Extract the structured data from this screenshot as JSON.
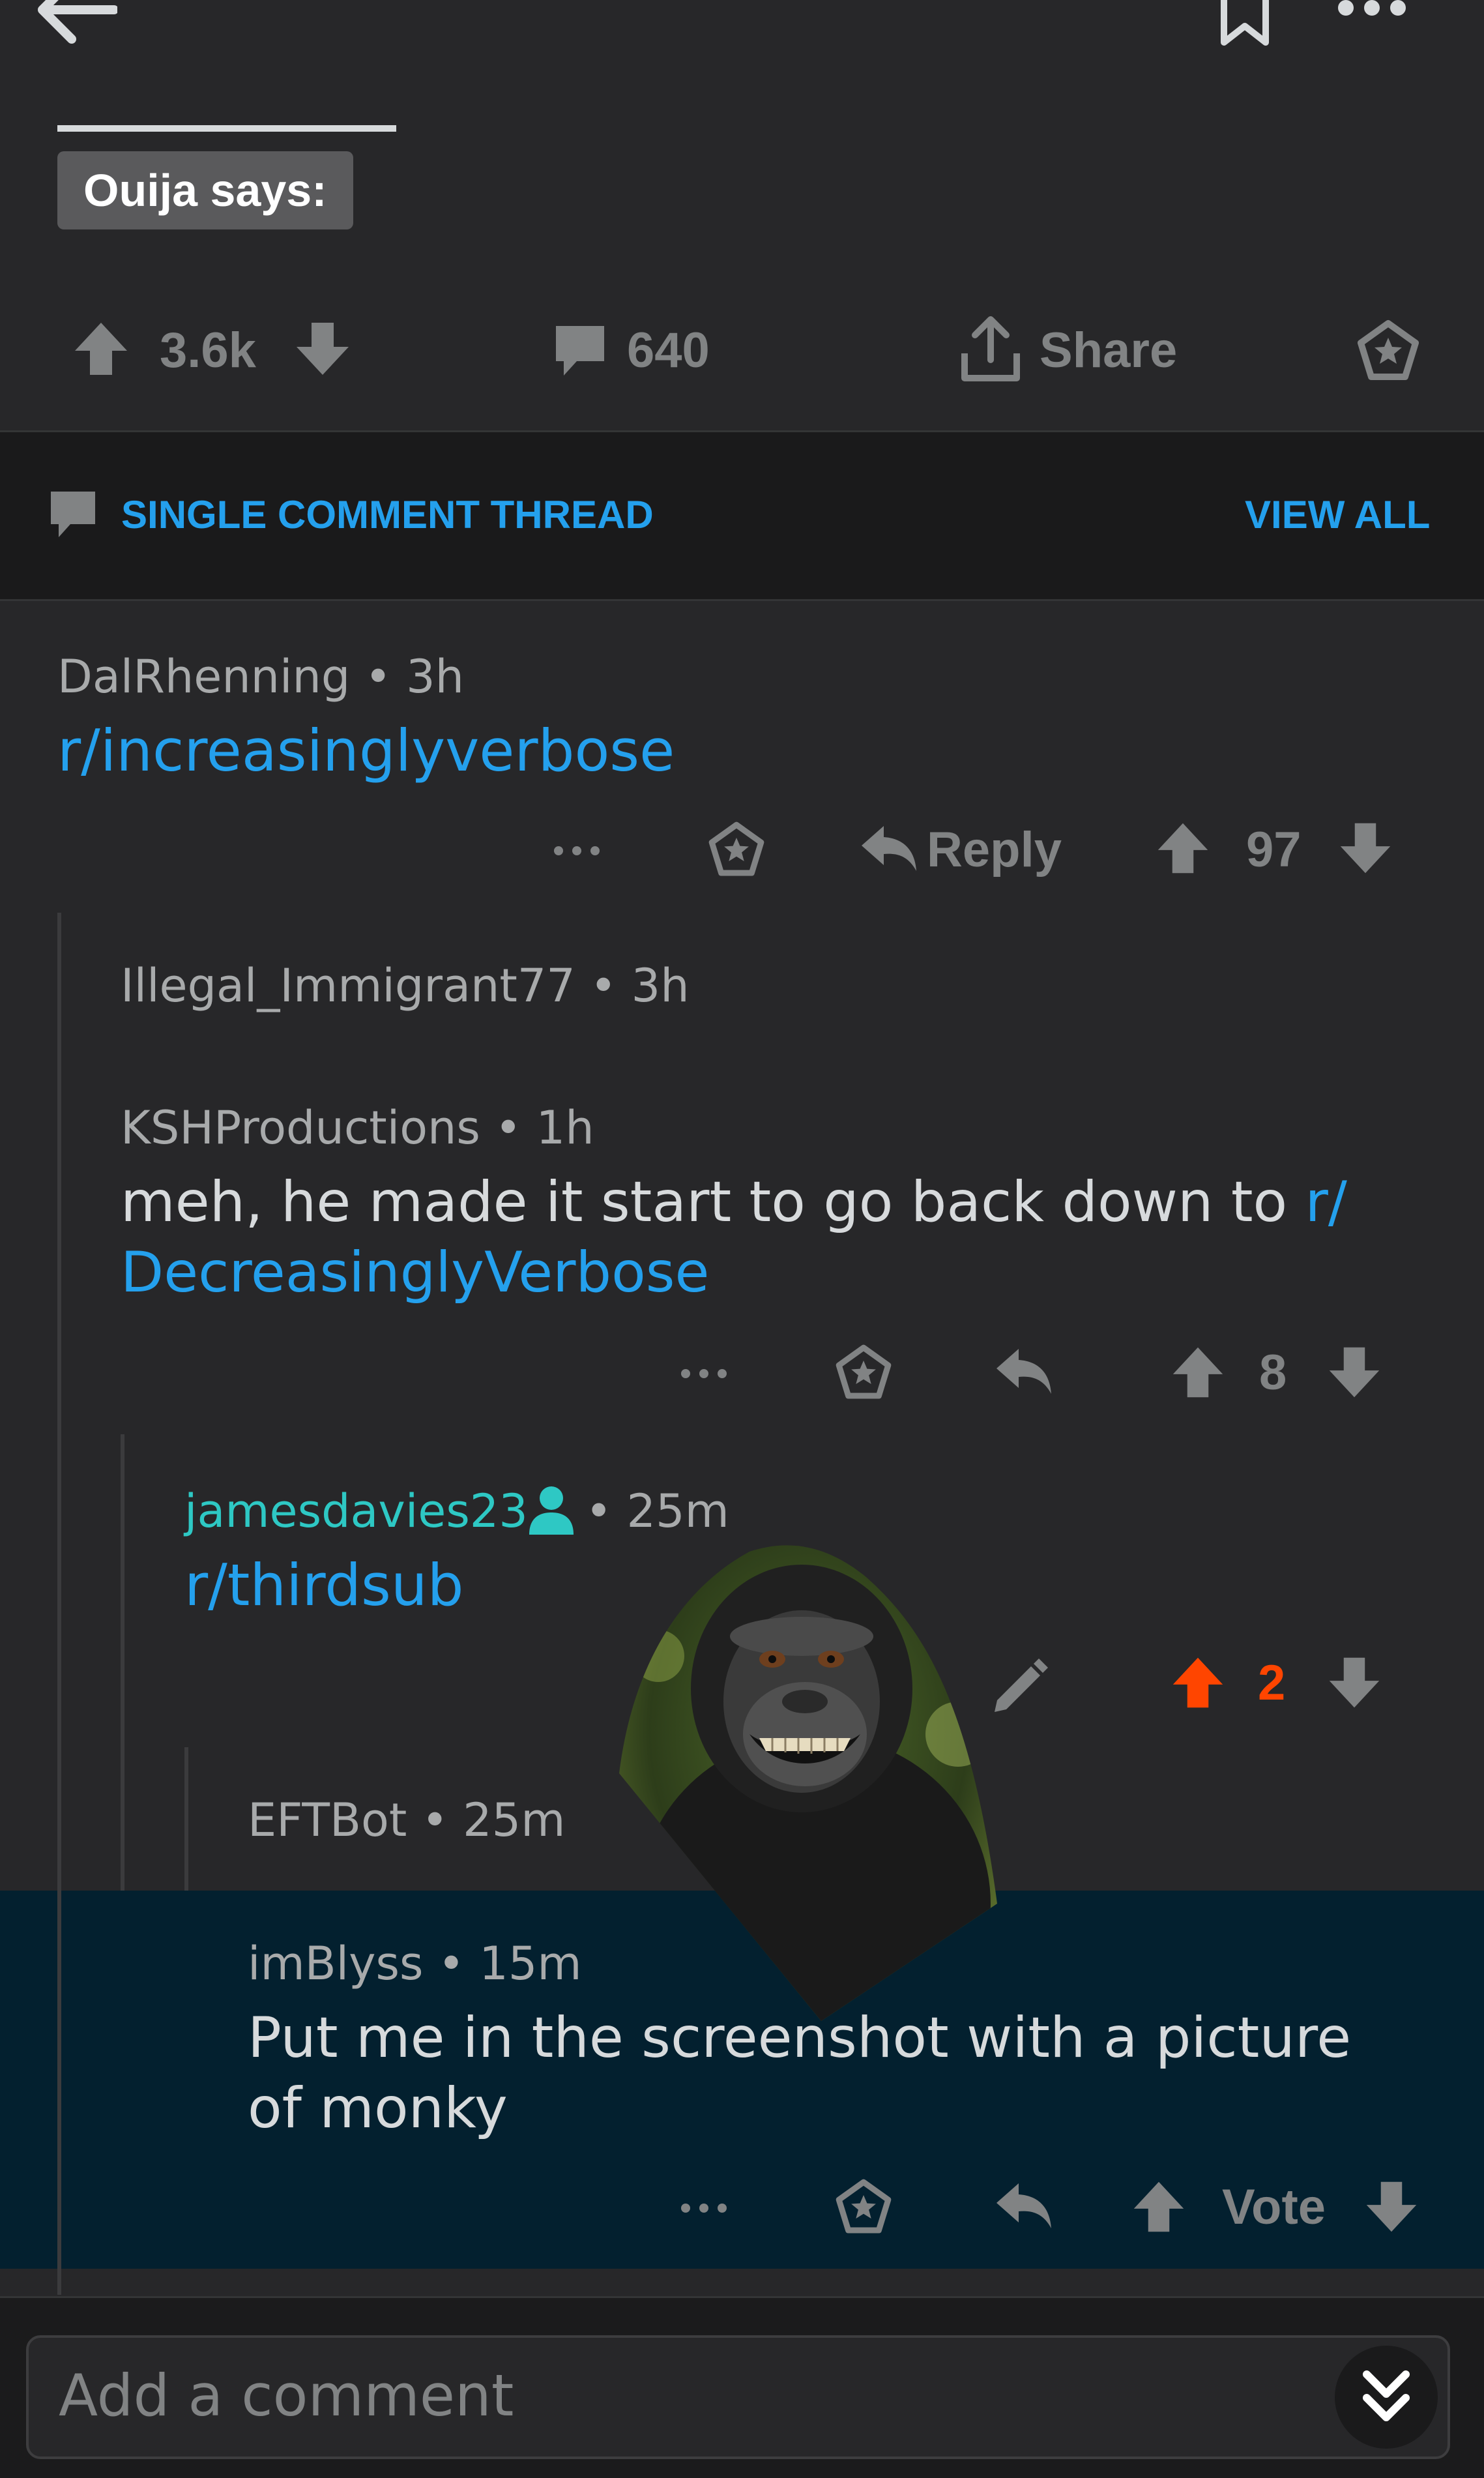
{
  "post": {
    "flair": "Ouija says:",
    "upvotes": "3.6k",
    "comments": "640",
    "share_label": "Share"
  },
  "thread_bar": {
    "title": "SINGLE COMMENT THREAD",
    "view_all": "VIEW ALL"
  },
  "comments": [
    {
      "author": "DalRhenning",
      "age": "3h",
      "text": "r/increasinglyverbose",
      "reply_label": "Reply",
      "score": "97"
    },
    {
      "author": "Illegal_Immigrant77",
      "age": "3h"
    },
    {
      "author": "KSHProductions",
      "age": "1h",
      "text_prefix": "meh, he made it start to go back down to ",
      "text_link_line1": "r/",
      "text_link_line2": "DecreasinglyVerbose",
      "score": "8"
    },
    {
      "author": "jamesdavies23",
      "age": "25m",
      "text": "r/thirdsub",
      "score": "2"
    },
    {
      "author": "EFTBot",
      "age": "25m"
    },
    {
      "author": "imBlyss",
      "age": "15m",
      "text": "Put me in the screenshot with a picture of monky",
      "vote_label": "Vote"
    }
  ],
  "composer": {
    "placeholder": "Add a comment"
  },
  "colors": {
    "background": "#272729",
    "link": "#24a0ed",
    "op_author": "#2ec8c4",
    "upvoted": "#ff4500",
    "highlight": "#03202f"
  },
  "icons": [
    "back-arrow-icon",
    "bookmark-icon",
    "more-icon",
    "upvote-icon",
    "downvote-icon",
    "comment-icon",
    "share-icon",
    "award-icon",
    "reply-icon",
    "edit-icon",
    "user-icon",
    "double-chevron-down-icon"
  ]
}
